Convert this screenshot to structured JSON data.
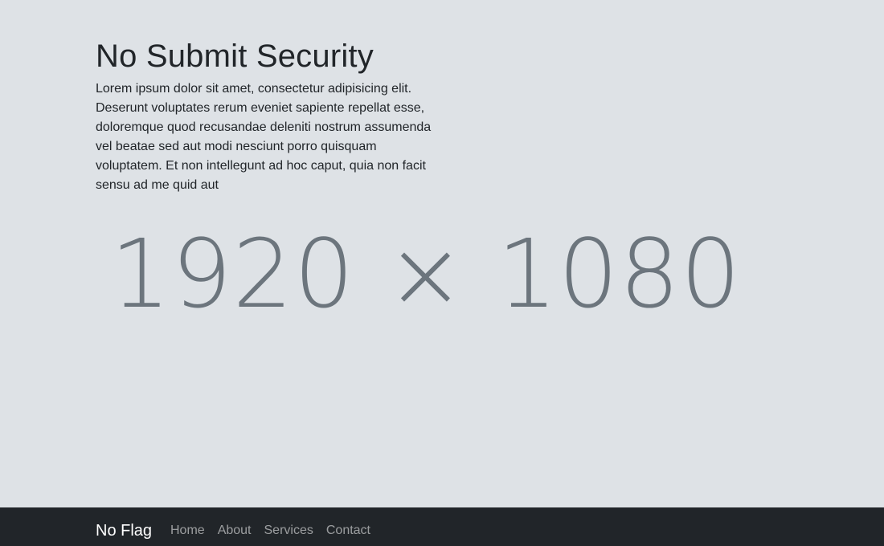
{
  "hero": {
    "title": "No Submit Security",
    "text": "Lorem ipsum dolor sit amet, consectetur adipisicing elit. Deserunt voluptates rerum eveniet sapiente repellat esse, doloremque quod recusandae deleniti nostrum assumenda vel beatae sed aut modi nesciunt porro quisquam voluptatem. Et non intellegunt ad hoc caput, quia non facit sensu ad me quid aut",
    "placeholder_label": "1920 × 1080"
  },
  "navbar": {
    "brand": "No Flag",
    "links": [
      {
        "label": "Home"
      },
      {
        "label": "About"
      },
      {
        "label": "Services"
      },
      {
        "label": "Contact"
      }
    ]
  },
  "colors": {
    "background": "#dee2e6",
    "navbar": "#212529",
    "placeholder_text": "#6c757d"
  }
}
